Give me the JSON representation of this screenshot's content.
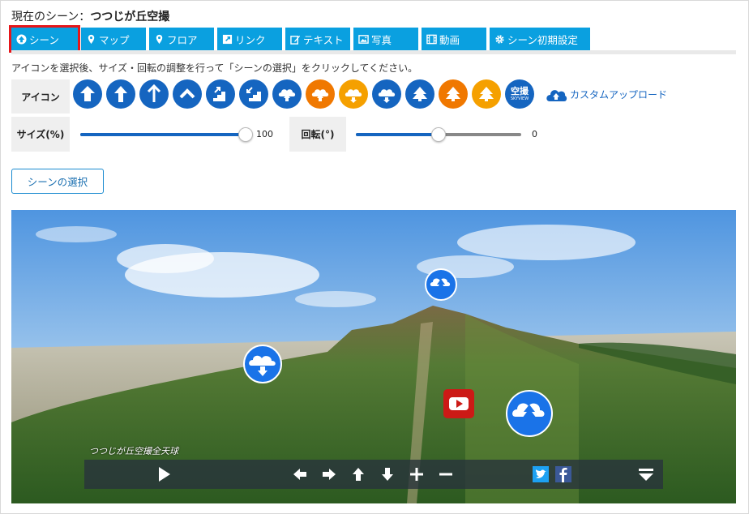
{
  "current_scene": {
    "label": "現在のシーン：",
    "name": "つつじが丘空撮"
  },
  "tabs": [
    {
      "label": "シーン",
      "icon": "arrow-up-circle-icon",
      "active": true
    },
    {
      "label": "マップ",
      "icon": "map-pin-icon"
    },
    {
      "label": "フロア",
      "icon": "map-pin-icon"
    },
    {
      "label": "リンク",
      "icon": "external-link-icon"
    },
    {
      "label": "テキスト",
      "icon": "edit-icon"
    },
    {
      "label": "写真",
      "icon": "image-icon"
    },
    {
      "label": "動画",
      "icon": "film-icon"
    },
    {
      "label": "シーン初期設定",
      "icon": "gear-icon"
    }
  ],
  "hint": "アイコンを選択後、サイズ・回転の調整を行って「シーンの選択」をクリックしてください。",
  "icon_row": {
    "label": "アイコン",
    "skyview_text": "空撮",
    "skyview_sub": "SKYVIEW",
    "upload_label": "カスタムアップロード"
  },
  "size": {
    "label": "サイズ(%)",
    "value": "100",
    "fraction": 1.0
  },
  "rotation": {
    "label": "回転(°)",
    "value": "0",
    "fraction": 0.5
  },
  "select_button": "シーンの選択",
  "viewer": {
    "caption": "つつじが丘空撮全天球"
  },
  "colors": {
    "tab": "#0aa0e0",
    "blue": "#1565c0",
    "orange": "#f07800",
    "amber": "#f5a000",
    "active_border": "#e6161a"
  }
}
